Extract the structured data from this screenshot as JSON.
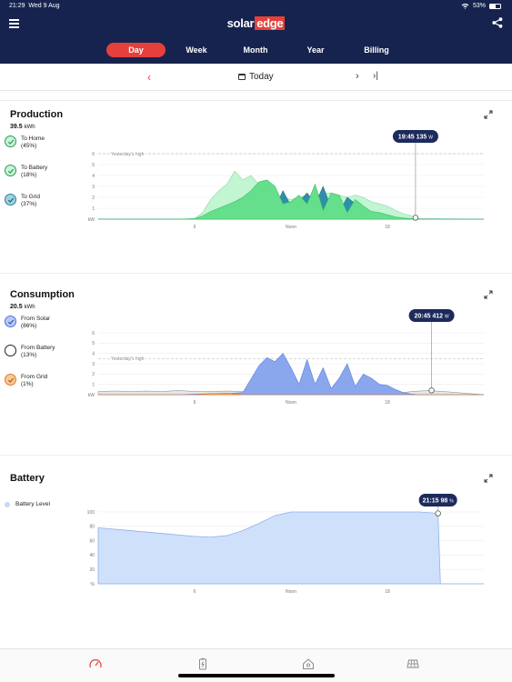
{
  "status": {
    "time": "21:29",
    "date": "Wed 9 Aug",
    "battery": "53%"
  },
  "header": {
    "logo_left": "solar",
    "logo_right": "edge",
    "tabs": [
      {
        "label": "Day",
        "active": true
      },
      {
        "label": "Week",
        "active": false
      },
      {
        "label": "Month",
        "active": false
      },
      {
        "label": "Year",
        "active": false
      },
      {
        "label": "Billing",
        "active": false
      }
    ]
  },
  "date_nav": {
    "label": "Today",
    "prev_icon": "chevron-left",
    "next_icon": "chevron-right",
    "last_icon": "skip-to-end"
  },
  "production": {
    "title": "Production",
    "total_value": "39.5",
    "total_unit": "kWh",
    "legend": [
      {
        "name": "To Home",
        "pct": "(45%)",
        "color": "#2a9d55",
        "fill": "#c9f3d9"
      },
      {
        "name": "To Battery",
        "pct": "(18%)",
        "color": "#2a9d55",
        "fill": "#c9f3d9"
      },
      {
        "name": "To Grid",
        "pct": "(37%)",
        "color": "#2a7d9a",
        "fill": "#9bd4e0"
      }
    ],
    "tooltip": {
      "time": "19:45",
      "value": "135",
      "unit": "W"
    }
  },
  "consumption": {
    "title": "Consumption",
    "total_value": "20.5",
    "total_unit": "kWh",
    "legend": [
      {
        "name": "From Solar",
        "pct": "(86%)",
        "color": "#4e70d6",
        "fill": "#b9c9f3"
      },
      {
        "name": "From Battery",
        "pct": "(13%)",
        "color": "#222222",
        "fill": "#ffffff"
      },
      {
        "name": "From Grid",
        "pct": "(1%)",
        "color": "#e07a20",
        "fill": "#f6c99a"
      }
    ],
    "tooltip": {
      "time": "20:45",
      "value": "412",
      "unit": "W"
    }
  },
  "battery": {
    "title": "Battery",
    "legend_label": "Battery Level",
    "tooltip": {
      "time": "21:15",
      "value": "98",
      "unit": "%"
    }
  },
  "colors": {
    "navy": "#16234f",
    "accent_red": "#e5403b",
    "home_green": "#c2f5d2",
    "battery_green": "#66df8c",
    "grid_teal": "#2d90a8",
    "consumption_blue": "#8aa7ee",
    "battery_level_fill": "#cfe0fb"
  },
  "chart_data": [
    {
      "type": "area",
      "title": "Production",
      "ylabel": "kW",
      "ylim": [
        0,
        6
      ],
      "yticks": [
        "kW",
        "1",
        "2",
        "3",
        "4",
        "5",
        "6"
      ],
      "xticks": [
        "6",
        "Noon",
        "18"
      ],
      "xlim": [
        0,
        24
      ],
      "reference_line": {
        "label": "Yesterday's high",
        "value": 6
      },
      "x": [
        0,
        5,
        6,
        6.5,
        7,
        7.5,
        8,
        8.5,
        9,
        9.5,
        10,
        10.5,
        11,
        11.5,
        12,
        12.5,
        13,
        13.5,
        14,
        14.5,
        15,
        15.5,
        16,
        16.5,
        17,
        17.5,
        18,
        18.5,
        19,
        19.5,
        19.75,
        20,
        24
      ],
      "series": [
        {
          "name": "To Home",
          "values": [
            0,
            0,
            0.05,
            0.6,
            1.8,
            2.6,
            3.2,
            4.4,
            3.6,
            4.0,
            3.2,
            2.4,
            2.2,
            2.0,
            1.8,
            2.0,
            2.2,
            2.0,
            2.4,
            2.4,
            2.2,
            2.0,
            2.2,
            2.0,
            1.6,
            1.4,
            1.2,
            0.8,
            0.5,
            0.3,
            0.13,
            0.05,
            0
          ]
        },
        {
          "name": "To Battery",
          "values": [
            0,
            0,
            0.05,
            0.3,
            0.7,
            1.0,
            1.3,
            1.6,
            2.0,
            2.6,
            3.4,
            3.6,
            3.0,
            1.4,
            1.6,
            2.2,
            1.4,
            3.2,
            0.8,
            2.4,
            2.2,
            0.6,
            1.8,
            1.2,
            0.7,
            0.6,
            0.4,
            0.2,
            0.1,
            0.05,
            0.02,
            0,
            0
          ]
        },
        {
          "name": "To Grid",
          "values": [
            0,
            0,
            0,
            0,
            0,
            0,
            0,
            0,
            0,
            0,
            0.4,
            0,
            1.0,
            2.6,
            1.2,
            1.6,
            2.4,
            1.4,
            3.0,
            1.0,
            0.6,
            2.0,
            1.4,
            0.4,
            0.4,
            0.3,
            0.2,
            0,
            0,
            0,
            0,
            0,
            0
          ]
        }
      ]
    },
    {
      "type": "area",
      "title": "Consumption",
      "ylabel": "kW",
      "ylim": [
        0,
        6
      ],
      "yticks": [
        "kW",
        "1",
        "2",
        "3",
        "4",
        "5",
        "6"
      ],
      "xticks": [
        "6",
        "Noon",
        "18"
      ],
      "xlim": [
        0,
        24
      ],
      "reference_line": {
        "label": "Yesterday's high",
        "value": 3.5
      },
      "x": [
        0,
        1,
        2,
        3,
        4,
        5,
        6,
        7,
        8,
        9,
        10,
        10.5,
        11,
        11.5,
        12,
        12.5,
        13,
        13.5,
        14,
        14.5,
        15,
        15.5,
        16,
        16.5,
        17,
        17.5,
        18,
        18.5,
        19,
        19.5,
        20,
        20.5,
        20.75,
        21,
        21.5,
        24
      ],
      "series": [
        {
          "name": "From Solar",
          "values": [
            0,
            0,
            0,
            0,
            0,
            0,
            0.05,
            0.1,
            0.1,
            0.2,
            2.8,
            3.6,
            3.2,
            4.0,
            2.6,
            1.0,
            3.4,
            1.0,
            2.6,
            0.6,
            1.6,
            3.0,
            0.8,
            2.0,
            1.6,
            1.0,
            0.9,
            0.5,
            0.2,
            0.05,
            0,
            0,
            0,
            0,
            0,
            0
          ]
        },
        {
          "name": "From Battery",
          "values": [
            0.3,
            0.35,
            0.3,
            0.35,
            0.3,
            0.4,
            0.3,
            0.3,
            0.35,
            0.3,
            0.1,
            0,
            0,
            0,
            0,
            0,
            0,
            0,
            0,
            0,
            0,
            0,
            0,
            0,
            0,
            0,
            0,
            0,
            0.2,
            0.3,
            0.35,
            0.4,
            0.41,
            0.35,
            0.3,
            0
          ]
        },
        {
          "name": "From Grid",
          "values": [
            0,
            0,
            0,
            0,
            0,
            0,
            0,
            0.1,
            0.15,
            0,
            0,
            0,
            0,
            0,
            0,
            0,
            0,
            0,
            0,
            0,
            0,
            0,
            0,
            0,
            0,
            0,
            0,
            0,
            0,
            0,
            0,
            0,
            0,
            0,
            0,
            0
          ]
        }
      ]
    },
    {
      "type": "area",
      "title": "Battery",
      "ylabel": "%",
      "ylim": [
        0,
        100
      ],
      "yticks": [
        "%",
        "20",
        "40",
        "60",
        "80",
        "100"
      ],
      "xticks": [
        "6",
        "Noon",
        "18"
      ],
      "xlim": [
        0,
        24
      ],
      "x": [
        0,
        2,
        4,
        6,
        7,
        8,
        9,
        10,
        11,
        12,
        14,
        16,
        18,
        20,
        21.15,
        21.3,
        24
      ],
      "series": [
        {
          "name": "Battery Level",
          "values": [
            78,
            74,
            70,
            66,
            65,
            67,
            74,
            84,
            95,
            100,
            100,
            100,
            100,
            100,
            98,
            0,
            0
          ]
        }
      ]
    }
  ]
}
